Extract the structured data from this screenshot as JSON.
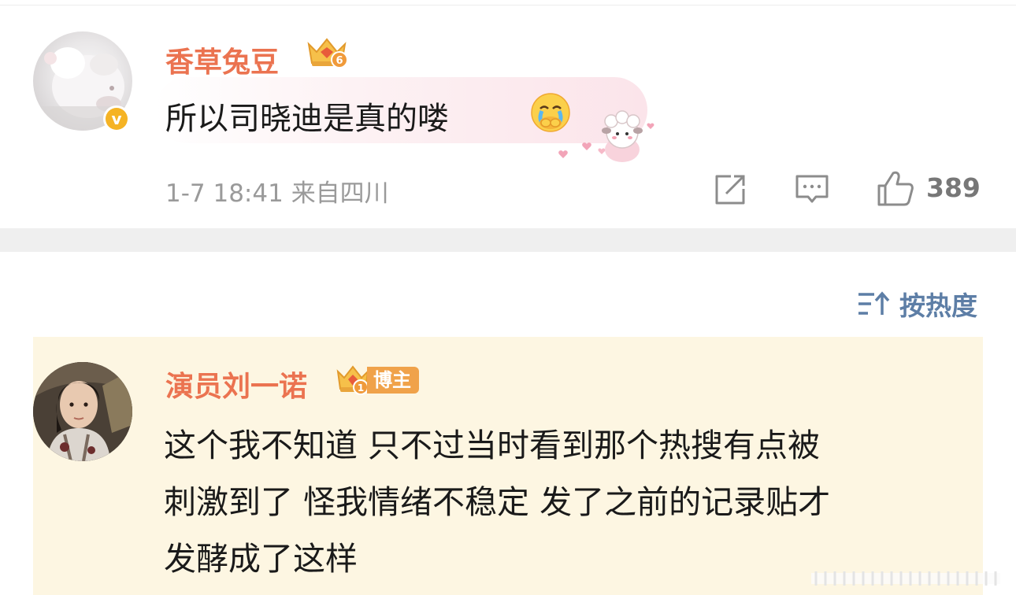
{
  "comments": [
    {
      "username": "香草兔豆",
      "level_badge": "6",
      "verified_badge": "v",
      "text": "所以司晓迪是真的喽",
      "emoji_icon": "crying-face-icon",
      "timestamp": "1-7 18:41",
      "location": "来自四川",
      "like_count": "389"
    },
    {
      "username": "演员刘一诺",
      "level_badge": "1",
      "role_tag": "博主",
      "lines": [
        "这个我不知道 只不过当时看到那个热搜有点被",
        "刺激到了 怪我情绪不稳定 发了之前的记录贴才",
        "发酵成了这样"
      ]
    }
  ],
  "sort": {
    "label": "按热度",
    "icon": "sort-icon"
  },
  "colors": {
    "username": "#eb7350",
    "link": "#5d7ea6",
    "highlight_bg": "#fdf6e2",
    "separator": "#efefef",
    "meta_text": "#9a9a9a"
  }
}
